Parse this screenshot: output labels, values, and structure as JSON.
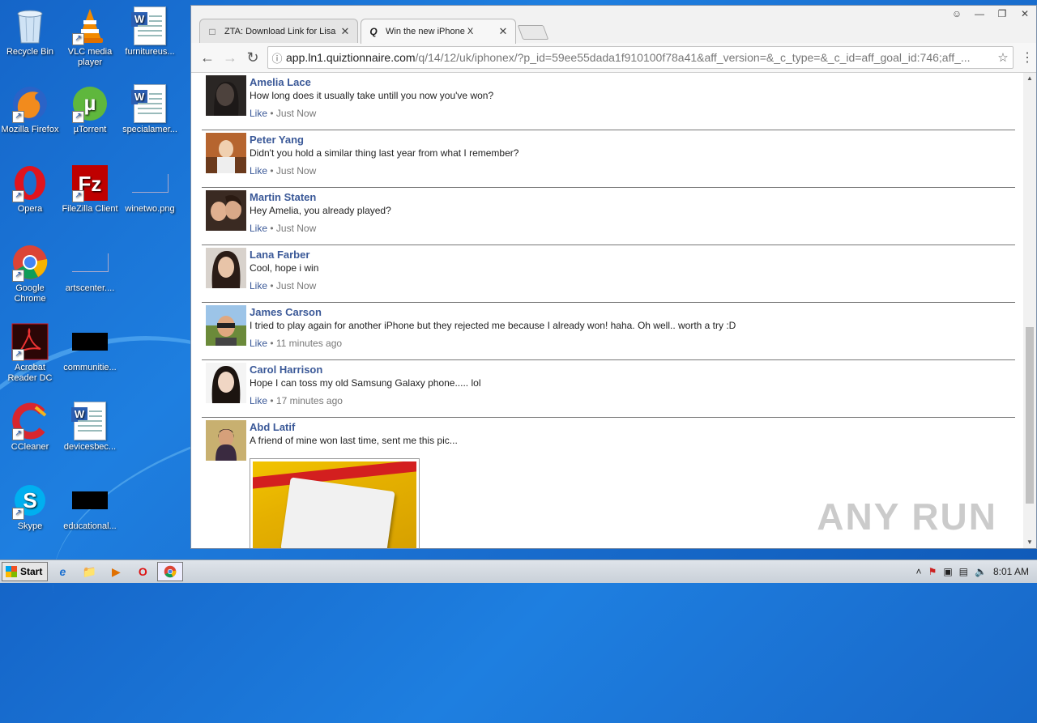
{
  "desktop": {
    "icons": [
      {
        "label": "Recycle Bin"
      },
      {
        "label": "VLC media player"
      },
      {
        "label": "furnitureus..."
      },
      {
        "label": "Mozilla Firefox"
      },
      {
        "label": "µTorrent"
      },
      {
        "label": "specialamer..."
      },
      {
        "label": "Opera"
      },
      {
        "label": "FileZilla Client"
      },
      {
        "label": "winetwo.png"
      },
      {
        "label": "Google Chrome"
      },
      {
        "label": "artscenter...."
      },
      {
        "label": "Acrobat Reader DC"
      },
      {
        "label": "communitie..."
      },
      {
        "label": "CCleaner"
      },
      {
        "label": "devicesbec..."
      },
      {
        "label": "Skype"
      },
      {
        "label": "educational..."
      }
    ]
  },
  "browser": {
    "tabs": [
      {
        "title": "ZTA: Download Link for Lisa"
      },
      {
        "title": "Win the new iPhone X"
      }
    ],
    "address": {
      "host": "app.ln1.quiztionnaire.com",
      "path": "/q/14/12/uk/iphonex/?p_id=59ee55dada1f910100f78a41&aff_version=&_c_type=&_c_id=aff_goal_id:746;aff_..."
    }
  },
  "comments": [
    {
      "name": "Amelia Lace",
      "text": "How long does it usually take untill you now you've won?",
      "like": "Like",
      "time": "Just Now"
    },
    {
      "name": "Peter Yang",
      "text": "Didn't you hold a similar thing last year from what I remember?",
      "like": "Like",
      "time": "Just Now"
    },
    {
      "name": "Martin Staten",
      "text": "Hey Amelia, you already played?",
      "like": "Like",
      "time": "Just Now"
    },
    {
      "name": "Lana Farber",
      "text": "Cool, hope i win",
      "like": "Like",
      "time": "Just Now"
    },
    {
      "name": "James Carson",
      "text": "I tried to play again for another iPhone but they rejected me because I already won! haha. Oh well.. worth a try :D",
      "like": "Like",
      "time": "11 minutes ago"
    },
    {
      "name": "Carol Harrison",
      "text": "Hope I can toss my old Samsung Galaxy phone..... lol",
      "like": "Like",
      "time": "17 minutes ago"
    },
    {
      "name": "Abd Latif",
      "text": "A friend of mine won last time, sent me this pic..."
    }
  ],
  "watermark": "ANY RUN",
  "taskbar": {
    "start_label": "Start",
    "clock": "8:01 AM"
  }
}
